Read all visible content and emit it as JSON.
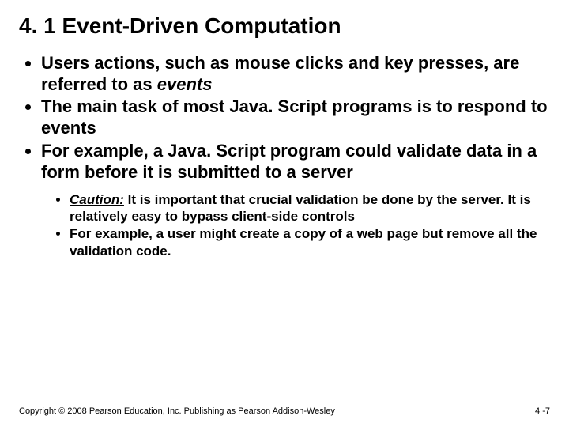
{
  "title": "4. 1 Event-Driven Computation",
  "bullets_level1": {
    "b0_pre": "Users actions, such as mouse clicks and key presses, are referred to as ",
    "b0_em": "events",
    "b1": "The main task of most Java. Script programs is to respond to events",
    "b2": "For example, a Java. Script program could validate data in a form before it is submitted to a server"
  },
  "bullets_level2": {
    "s0_label": "Caution:",
    "s0_rest": " It is important that crucial validation be done by the server.  It is relatively easy to bypass client-side controls",
    "s1": "For example, a user might create a copy of a web page but remove all the validation code."
  },
  "footer": "Copyright © 2008 Pearson Education, Inc. Publishing as Pearson Addison-Wesley",
  "pagenum": "4 -7"
}
